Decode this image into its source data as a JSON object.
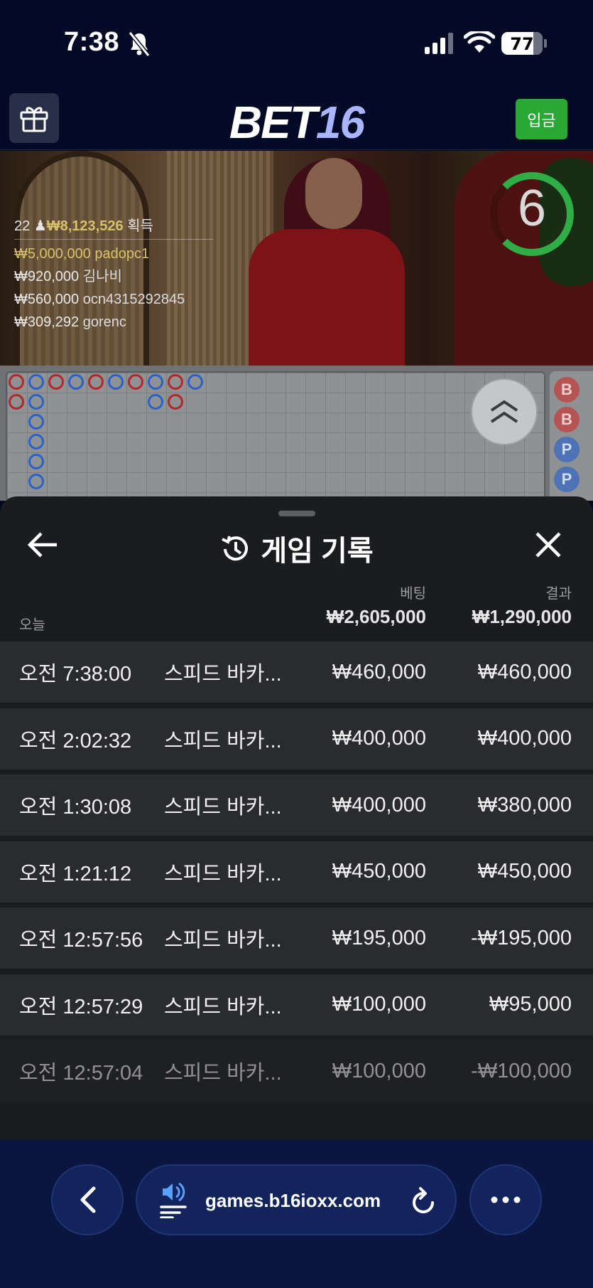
{
  "status_bar": {
    "time": "7:38",
    "battery": "77"
  },
  "header": {
    "logo_part1": "BET",
    "logo_part2": "16",
    "deposit_label": "입금"
  },
  "video": {
    "countdown": "6",
    "winners_count": "22",
    "winners_total": "₩8,123,526",
    "winners_suffix": "획득",
    "winners": [
      {
        "amount": "₩5,000,000",
        "name": "padopc1"
      },
      {
        "amount": "₩920,000",
        "name": "김나비"
      },
      {
        "amount": "₩560,000",
        "name": "ocn4315292845"
      },
      {
        "amount": "₩309,292",
        "name": "gorenc"
      }
    ]
  },
  "roadmap": {
    "side_chips": [
      "B",
      "B",
      "P",
      "P"
    ]
  },
  "history": {
    "title": "게임 기록",
    "col_bet": "베팅",
    "col_result": "결과",
    "today_label": "오늘",
    "total_bet": "₩2,605,000",
    "total_result": "₩1,290,000",
    "rows": [
      {
        "time": "오전 7:38:00",
        "game": "스피드 바카...",
        "bet": "₩460,000",
        "result": "₩460,000"
      },
      {
        "time": "오전 2:02:32",
        "game": "스피드 바카...",
        "bet": "₩400,000",
        "result": "₩400,000"
      },
      {
        "time": "오전 1:30:08",
        "game": "스피드 바카...",
        "bet": "₩400,000",
        "result": "₩380,000"
      },
      {
        "time": "오전 1:21:12",
        "game": "스피드 바카...",
        "bet": "₩450,000",
        "result": "₩450,000"
      },
      {
        "time": "오전 12:57:56",
        "game": "스피드 바카...",
        "bet": "₩195,000",
        "result": "-₩195,000"
      },
      {
        "time": "오전 12:57:29",
        "game": "스피드 바카...",
        "bet": "₩100,000",
        "result": "₩95,000"
      },
      {
        "time": "오전 12:57:04",
        "game": "스피드 바카...",
        "bet": "₩100,000",
        "result": "-₩100,000"
      }
    ]
  },
  "browser": {
    "url": "games.b16ioxx.com"
  },
  "colors": {
    "deposit": "#2aa835",
    "banker": "#b3272a",
    "player": "#2a63c6",
    "sheet_bg": "#1b1c1f",
    "row_bg": "#2a2b2f"
  }
}
